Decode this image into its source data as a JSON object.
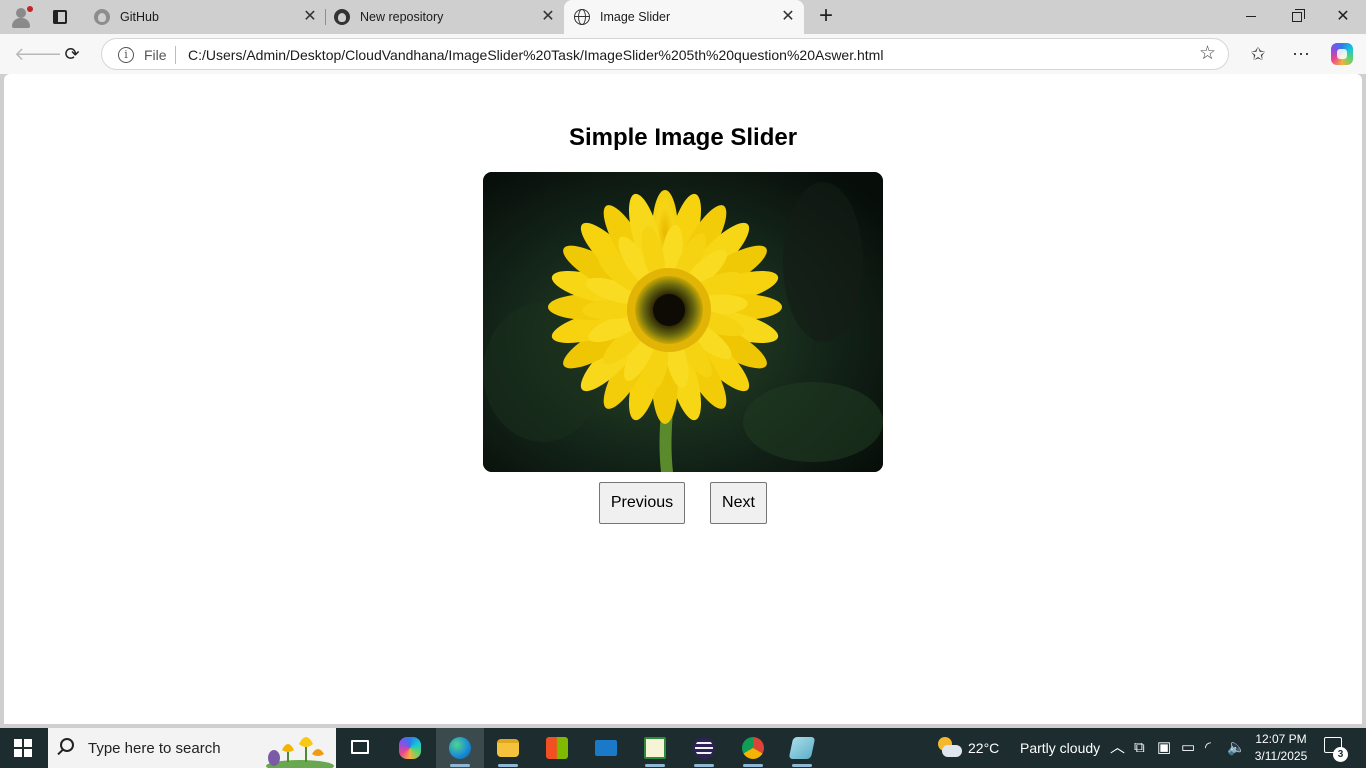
{
  "browser": {
    "tabs": [
      {
        "title": "GitHub",
        "close": "✕"
      },
      {
        "title": "New repository",
        "close": "✕"
      },
      {
        "title": "Image Slider",
        "close": "✕"
      }
    ],
    "new_tab": "+",
    "address": {
      "scheme_label": "File",
      "url": "C:/Users/Admin/Desktop/CloudVandhana/ImageSlider%20Task/ImageSlider%205th%20question%20Aswer.html"
    },
    "window_controls": {
      "close": "✕"
    }
  },
  "page": {
    "title": "Simple Image Slider",
    "current_image": "yellow-gerbera-daisy",
    "buttons": {
      "previous": "Previous",
      "next": "Next"
    }
  },
  "taskbar": {
    "search_placeholder": "Type here to search",
    "weather": {
      "temp": "22°C",
      "condition": "Partly cloudy"
    },
    "time": "12:07 PM",
    "date": "3/11/2025",
    "notifications": "3"
  },
  "colors": {
    "tab_strip": "#cfcfcf",
    "active_tab": "#f7f7f7",
    "taskbar": "#1c2c2f",
    "flower": "#f5d10a"
  }
}
